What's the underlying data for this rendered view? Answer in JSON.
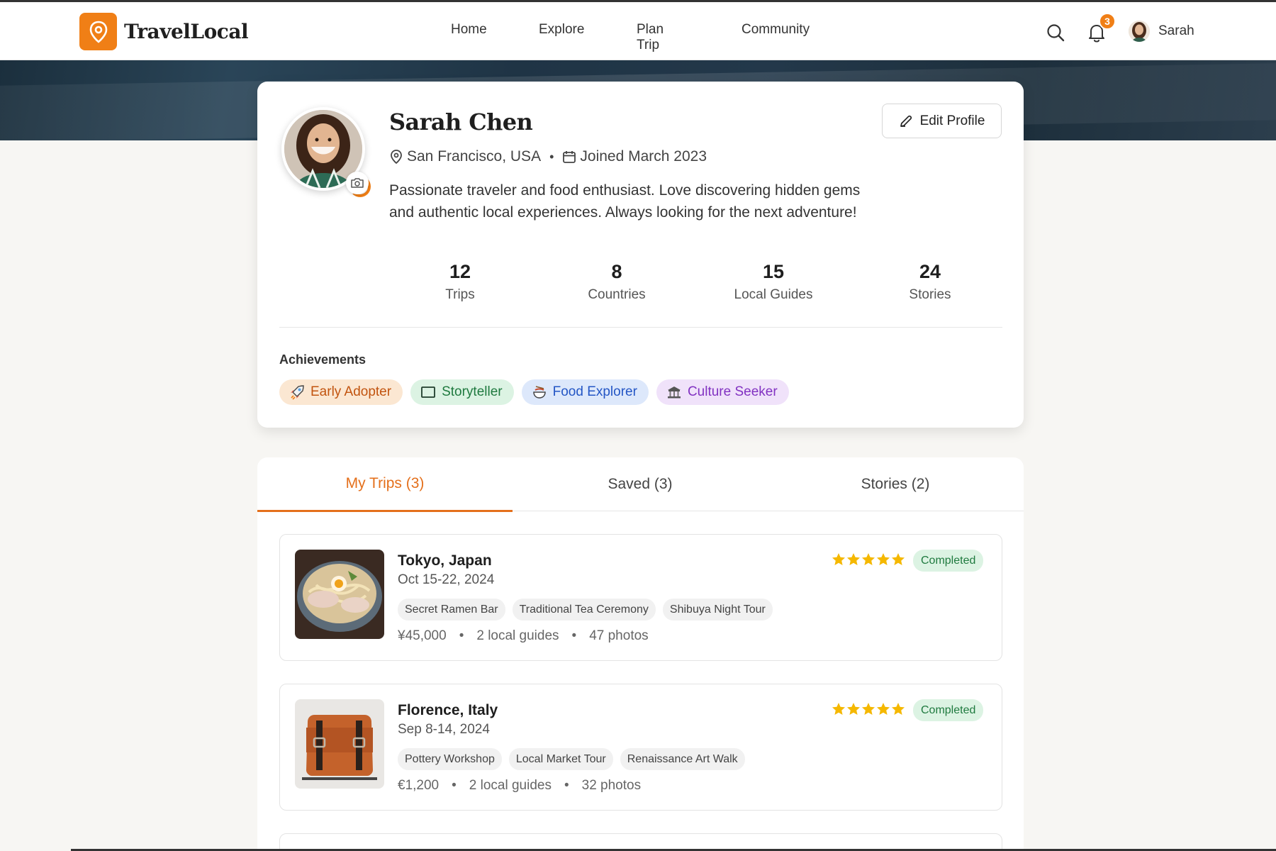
{
  "brand": {
    "name": "TravelLocal",
    "accent": "#f07f16"
  },
  "nav": {
    "links": [
      "Home",
      "Explore",
      "Plan Trip",
      "Community"
    ],
    "notifications_count": "3",
    "user_name": "Sarah"
  },
  "profile": {
    "name": "Sarah Chen",
    "location": "San Francisco, USA",
    "joined": "Joined March 2023",
    "bio": "Passionate traveler and food enthusiast. Love discovering hidden gems and authentic local experiences. Always looking for the next adventure!",
    "edit_label": "Edit Profile",
    "stats": [
      {
        "value": "12",
        "label": "Trips"
      },
      {
        "value": "8",
        "label": "Countries"
      },
      {
        "value": "15",
        "label": "Local Guides"
      },
      {
        "value": "24",
        "label": "Stories"
      }
    ],
    "achievements_title": "Achievements",
    "achievements": [
      {
        "label": "Early Adopter",
        "icon": "rocket-icon"
      },
      {
        "label": "Storyteller",
        "icon": "book-icon"
      },
      {
        "label": "Food Explorer",
        "icon": "food-bowl-icon"
      },
      {
        "label": "Culture Seeker",
        "icon": "museum-icon"
      }
    ]
  },
  "tabs": [
    {
      "label": "My Trips (3)",
      "active": true
    },
    {
      "label": "Saved (3)",
      "active": false
    },
    {
      "label": "Stories (2)",
      "active": false
    }
  ],
  "trips": [
    {
      "title": "Tokyo, Japan",
      "dates": "Oct 15-22, 2024",
      "tags": [
        "Secret Ramen Bar",
        "Traditional Tea Ceremony",
        "Shibuya Night Tour"
      ],
      "cost": "¥45,000",
      "guides": "2 local guides",
      "photos": "47 photos",
      "rating": 5,
      "status": "Completed",
      "image": "ramen-bowl-photo"
    },
    {
      "title": "Florence, Italy",
      "dates": "Sep 8-14, 2024",
      "tags": [
        "Pottery Workshop",
        "Local Market Tour",
        "Renaissance Art Walk"
      ],
      "cost": "€1,200",
      "guides": "2 local guides",
      "photos": "32 photos",
      "rating": 5,
      "status": "Completed",
      "image": "leather-bag-photo"
    }
  ]
}
